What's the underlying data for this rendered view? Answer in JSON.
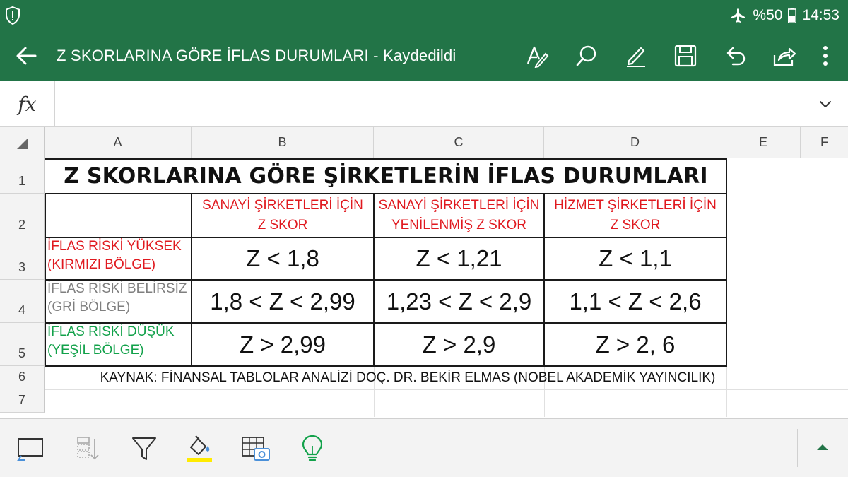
{
  "status_bar": {
    "battery_text": "%50",
    "time": "14:53",
    "icons": [
      "alert-shield-icon",
      "airplane-mode-icon",
      "battery-icon"
    ]
  },
  "app_bar": {
    "title": "Z SKORLARINA GÖRE İFLAS DURUMLARI - Kaydedildi",
    "icons": [
      "back-arrow-icon",
      "text-format-icon",
      "search-icon",
      "pen-draw-icon",
      "save-icon",
      "undo-icon",
      "share-icon",
      "more-options-icon"
    ]
  },
  "formula_bar": {
    "fx_label": "fx",
    "value": ""
  },
  "grid": {
    "columns": [
      "A",
      "B",
      "C",
      "D",
      "E",
      "F"
    ],
    "rows": [
      "1",
      "2",
      "3",
      "4",
      "5",
      "6",
      "7"
    ],
    "title": "Z SKORLARINA GÖRE ŞİRKETLERİN İFLAS DURUMLARI",
    "headers": [
      [
        "SANAYİ ŞİRKETLERİ İÇİN",
        "Z SKOR"
      ],
      [
        "SANAYİ ŞİRKETLERİ İÇİN",
        "YENİLENMİŞ Z SKOR"
      ],
      [
        "HİZMET ŞİRKETLERİ İÇİN",
        "Z SKOR"
      ]
    ],
    "risk_rows": [
      {
        "label": [
          "İFLAS RİSKİ YÜKSEK",
          "(KIRMIZI BÖLGE)"
        ],
        "color": "#e0191f",
        "values": [
          "Z < 1,8",
          "Z < 1,21",
          "Z < 1,1"
        ]
      },
      {
        "label": [
          "İFLAS RİSKİ BELİRSİZ",
          "(GRİ BÖLGE)"
        ],
        "color": "#7f7f7f",
        "values": [
          "1,8 < Z < 2,99",
          "1,23 < Z < 2,9",
          "1,1 < Z < 2,6"
        ]
      },
      {
        "label": [
          "İFLAS RİSKİ DÜŞÜK",
          "(YEŞİL BÖLGE)"
        ],
        "color": "#12a14a",
        "values": [
          "Z > 2,99",
          "Z > 2,9",
          "Z > 2, 6"
        ]
      }
    ],
    "source": "KAYNAK: FİNANSAL TABLOLAR ANALİZİ DOÇ. DR. BEKİR ELMAS (NOBEL AKADEMİK YAYINCILIK)"
  },
  "bottom_bar": {
    "tools": [
      "select-all-icon",
      "sort-icon",
      "filter-icon",
      "fill-color-icon",
      "insert-table-photo-icon",
      "lightbulb-ideas-icon",
      "expand-up-icon"
    ],
    "fill_color_swatch": "#ffeb00"
  },
  "colors": {
    "brand_green": "#227447",
    "header_red": "#e0191f",
    "gray_zone": "#7f7f7f",
    "green_zone": "#12a14a"
  }
}
